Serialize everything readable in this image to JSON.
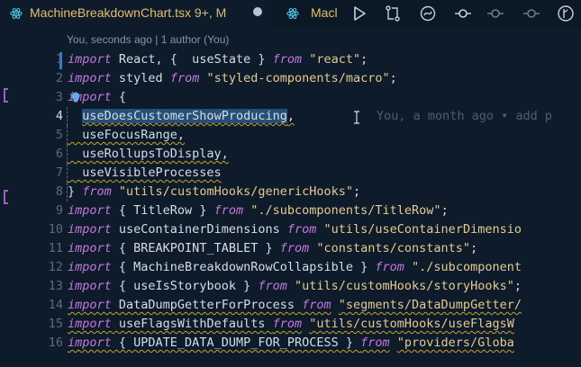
{
  "tabs": {
    "active": {
      "filename": "MachineBreakdownChart.tsx",
      "badge": "9+, M"
    },
    "second": {
      "filename": "Macl"
    }
  },
  "toolbar": {
    "icons": [
      "run-icon",
      "source-control-compare-icon",
      "open-changes-icon",
      "git-commit-icon",
      "git-commit-dot-icon",
      "git-commit-dot-2-icon",
      "git-timeline-icon"
    ]
  },
  "blame_header": "You, seconds ago | 1 author (You)",
  "ghost_blame": "You, a month ago • add p",
  "colors": {
    "keyword": "#c678dd",
    "string": "#e8c98f",
    "selection": "#264f78",
    "warning": "#c9a227",
    "accent": "#2f7fcf"
  },
  "lines": [
    {
      "n": "1",
      "parts": [
        [
          "kw",
          "import"
        ],
        [
          "var",
          " React, {  useState } "
        ],
        [
          "fr",
          "from"
        ],
        [
          "var",
          " "
        ],
        [
          "str",
          "\"react\""
        ],
        [
          "var",
          ";"
        ]
      ]
    },
    {
      "n": "2",
      "parts": [
        [
          "kw",
          "import"
        ],
        [
          "var",
          " styled "
        ],
        [
          "fr",
          "from"
        ],
        [
          "var",
          " "
        ],
        [
          "str",
          "\"styled-components/macro\""
        ],
        [
          "var",
          ";"
        ]
      ]
    },
    {
      "n": "3",
      "parts": [
        [
          "kw",
          "import"
        ],
        [
          "var",
          " {"
        ]
      ]
    },
    {
      "n": "4",
      "parts": [
        [
          "var",
          "  "
        ],
        [
          "sel",
          "useDoesCustomerShowProducing"
        ],
        [
          "var",
          ","
        ]
      ]
    },
    {
      "n": "5",
      "parts": [
        [
          "var",
          "  useFocusRange,"
        ]
      ]
    },
    {
      "n": "6",
      "parts": [
        [
          "var",
          "  useRollupsToDisplay,"
        ]
      ]
    },
    {
      "n": "7",
      "parts": [
        [
          "var",
          "  useVisibleProcesses"
        ]
      ]
    },
    {
      "n": "8",
      "parts": [
        [
          "var",
          "} "
        ],
        [
          "fr",
          "from"
        ],
        [
          "var",
          " "
        ],
        [
          "str",
          "\"utils/customHooks/genericHooks\""
        ],
        [
          "var",
          ";"
        ]
      ]
    },
    {
      "n": "9",
      "parts": [
        [
          "kw",
          "import"
        ],
        [
          "var",
          " { TitleRow } "
        ],
        [
          "fr",
          "from"
        ],
        [
          "var",
          " "
        ],
        [
          "str",
          "\"./subcomponents/TitleRow\""
        ],
        [
          "var",
          ";"
        ]
      ]
    },
    {
      "n": "10",
      "parts": [
        [
          "kw",
          "import"
        ],
        [
          "var",
          " useContainerDimensions "
        ],
        [
          "fr",
          "from"
        ],
        [
          "var",
          " "
        ],
        [
          "str",
          "\"utils/useContainerDimensio"
        ]
      ]
    },
    {
      "n": "11",
      "parts": [
        [
          "kw",
          "import"
        ],
        [
          "var",
          " { BREAKPOINT_TABLET } "
        ],
        [
          "fr",
          "from"
        ],
        [
          "var",
          " "
        ],
        [
          "str",
          "\"constants/constants\""
        ],
        [
          "var",
          ";"
        ]
      ]
    },
    {
      "n": "12",
      "parts": [
        [
          "kw",
          "import"
        ],
        [
          "var",
          " { MachineBreakdownRowCollapsible } "
        ],
        [
          "fr",
          "from"
        ],
        [
          "var",
          " "
        ],
        [
          "str",
          "\"./subcomponent"
        ]
      ]
    },
    {
      "n": "13",
      "parts": [
        [
          "kw",
          "import"
        ],
        [
          "var",
          " { useIsStorybook } "
        ],
        [
          "fr",
          "from"
        ],
        [
          "var",
          " "
        ],
        [
          "str",
          "\"utils/customHooks/storyHooks\""
        ],
        [
          "var",
          ";"
        ]
      ]
    },
    {
      "n": "14",
      "parts": [
        [
          "kw",
          "import"
        ],
        [
          "var",
          " DataDumpGetterForProcess "
        ],
        [
          "fr",
          "from"
        ],
        [
          "var",
          " "
        ],
        [
          "str",
          "\"segments/DataDumpGetter/"
        ]
      ]
    },
    {
      "n": "15",
      "parts": [
        [
          "kw",
          "import"
        ],
        [
          "var",
          " useFlagsWithDefaults "
        ],
        [
          "fr",
          "from"
        ],
        [
          "var",
          " "
        ],
        [
          "str",
          "\"utils/customHooks/useFlagsW"
        ]
      ]
    },
    {
      "n": "16",
      "parts": [
        [
          "kw",
          "import"
        ],
        [
          "var",
          " { UPDATE_DATA_DUMP_FOR_PROCESS } "
        ],
        [
          "fr",
          "from"
        ],
        [
          "var",
          " "
        ],
        [
          "str",
          "\"providers/Globa"
        ]
      ]
    }
  ]
}
